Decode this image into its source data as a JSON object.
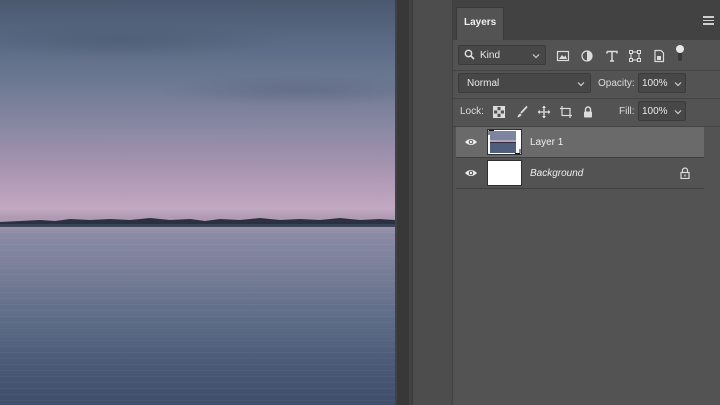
{
  "panel": {
    "tab_label": "Layers",
    "filter": {
      "kind_label": "Kind"
    },
    "blend_mode": "Normal",
    "opacity": {
      "label": "Opacity:",
      "value": "100%"
    },
    "lock": {
      "label": "Lock:"
    },
    "fill": {
      "label": "Fill:",
      "value": "100%"
    },
    "layers": [
      {
        "name": "Layer 1",
        "visible": true,
        "selected": true,
        "locked": false,
        "thumbnail": "photo"
      },
      {
        "name": "Background",
        "visible": true,
        "selected": false,
        "locked": true,
        "thumbnail": "white"
      }
    ]
  },
  "colors": {
    "panel_bg": "#535353",
    "selected_row": "#6a6a6a",
    "tab_bar": "#424242"
  }
}
